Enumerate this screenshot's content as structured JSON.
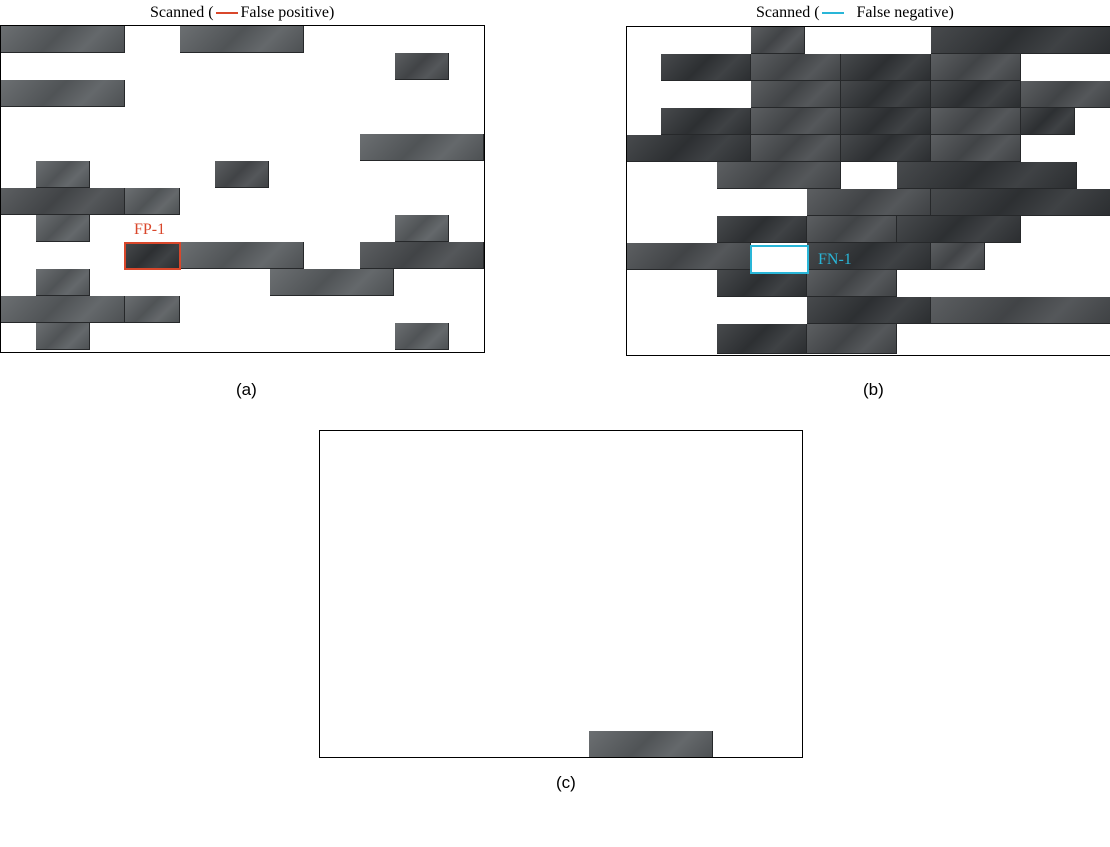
{
  "legend_a": {
    "prefix": "Scanned (",
    "label": "False positive)",
    "line_color": "#d9472b"
  },
  "legend_b": {
    "prefix": "Scanned (",
    "label": "False negative)",
    "line_color": "#29b6d8"
  },
  "tag_fp": {
    "text": "FP-1",
    "color": "#d9472b"
  },
  "tag_fn": {
    "text": "FN-1",
    "color": "#29b6d8"
  },
  "captions": {
    "a": "(a)",
    "b": "(b)",
    "c": "(c)"
  },
  "colors": {
    "stone_light": "#5b5f62",
    "stone_mid": "#4a4d50",
    "stone_dark": "#333639",
    "mortar": "#26282a"
  }
}
